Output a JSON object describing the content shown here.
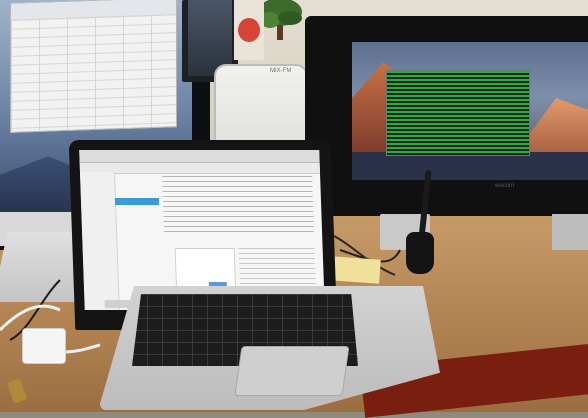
{
  "scene": {
    "description_label": "",
    "colors": {
      "wall": "#d8d3c5",
      "desk": "#b98b5a",
      "desk_edge": "#7f1f12",
      "laptop_body": "#c9c9c9",
      "laptop_bezel": "#1a1a1a",
      "tablet_bezel": "#111111",
      "terminal_green": "#38b24a",
      "mountain_sky": "#5b6f91",
      "mountain_peak": "#c67a52"
    }
  },
  "tablet_display": {
    "brand": "wacom"
  },
  "external_monitor": {
    "spreadsheet_label": ""
  },
  "speaker": {
    "brand": "MIX-FM"
  },
  "laptop": {
    "browser": {
      "sidebar_highlight": "",
      "heading": ""
    }
  }
}
